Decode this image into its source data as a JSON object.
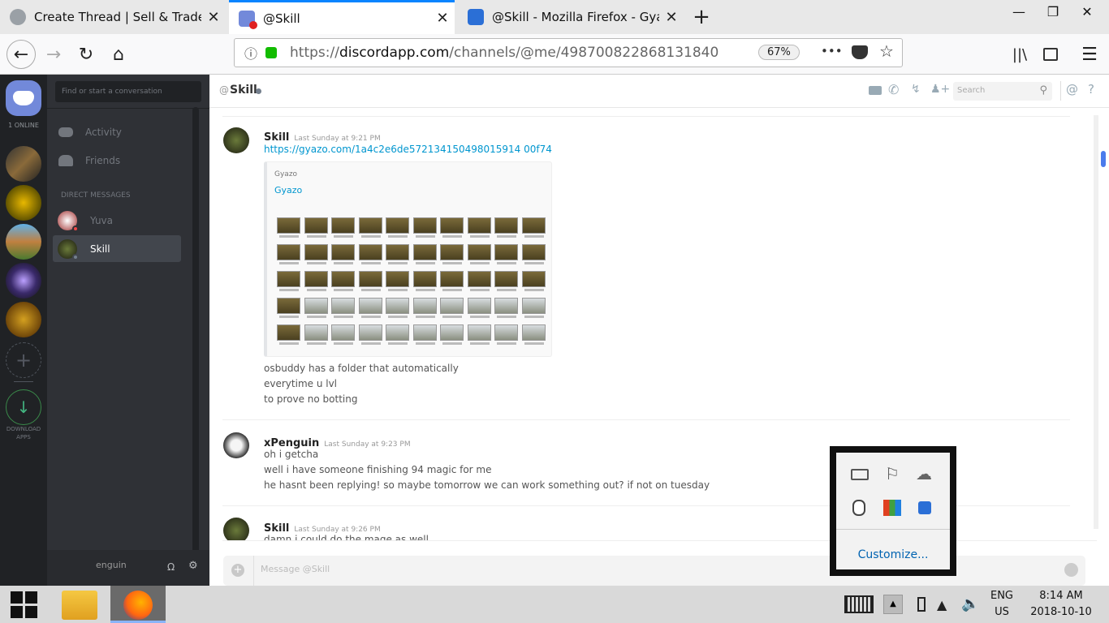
{
  "browser": {
    "tabs": [
      {
        "title": "Create Thread | Sell & Trade Ga",
        "close": "✕"
      },
      {
        "title": "@Skill",
        "close": "✕"
      },
      {
        "title": "@Skill - Mozilla Firefox - Gyazo",
        "close": "✕"
      }
    ],
    "new_tab": "+",
    "window": {
      "minimize": "—",
      "maximize": "❐",
      "close": "✕"
    },
    "url_prefix": "https://",
    "url_host": "discordapp.com",
    "url_path": "/channels/@me/498700822868131840",
    "zoom": "67%",
    "more": "•••"
  },
  "discord": {
    "online_count": "1 ONLINE",
    "download_label_1": "DOWNLOAD",
    "download_label_2": "APPS",
    "search_placeholder": "Find or start a conversation",
    "nav": [
      {
        "label": "Activity"
      },
      {
        "label": "Friends"
      }
    ],
    "dm_header": "DIRECT MESSAGES",
    "dms": [
      {
        "name": "Yuva"
      },
      {
        "name": "Skill"
      }
    ],
    "user_partial": "enguin",
    "chat_header": {
      "at": "@",
      "name": "Skill",
      "search_placeholder": "Search"
    },
    "messages": [
      {
        "author": "Skill",
        "timestamp": "Last Sunday at 9:21 PM",
        "link": "https://gyazo.com/1a4c2e6de572134150498015914 00f74",
        "embed_provider": "Gyazo",
        "embed_title": "Gyazo",
        "lines": [
          "osbuddy has a folder that automatically",
          "everytime u lvl",
          "to prove no botting"
        ]
      },
      {
        "author": "xPenguin",
        "timestamp": "Last Sunday at 9:23 PM",
        "lines": [
          "oh i getcha",
          "well i have someone finishing 94 magic for me",
          "he hasnt been replying! so maybe tomorrow we can work something out? if not on tuesday"
        ]
      },
      {
        "author": "Skill",
        "timestamp": "Last Sunday at 9:26 PM",
        "lines": [
          "damn i could do the mage as well"
        ]
      }
    ],
    "composer_placeholder": "Message @Skill"
  },
  "tray_popup": {
    "customize": "Customize..."
  },
  "taskbar": {
    "lang1": "ENG",
    "lang2": "US",
    "time": "8:14 AM",
    "date": "2018-10-10"
  },
  "colors": {
    "accent": "#0a84ff",
    "discord_blurple": "#7289da",
    "link": "#0096cf"
  }
}
